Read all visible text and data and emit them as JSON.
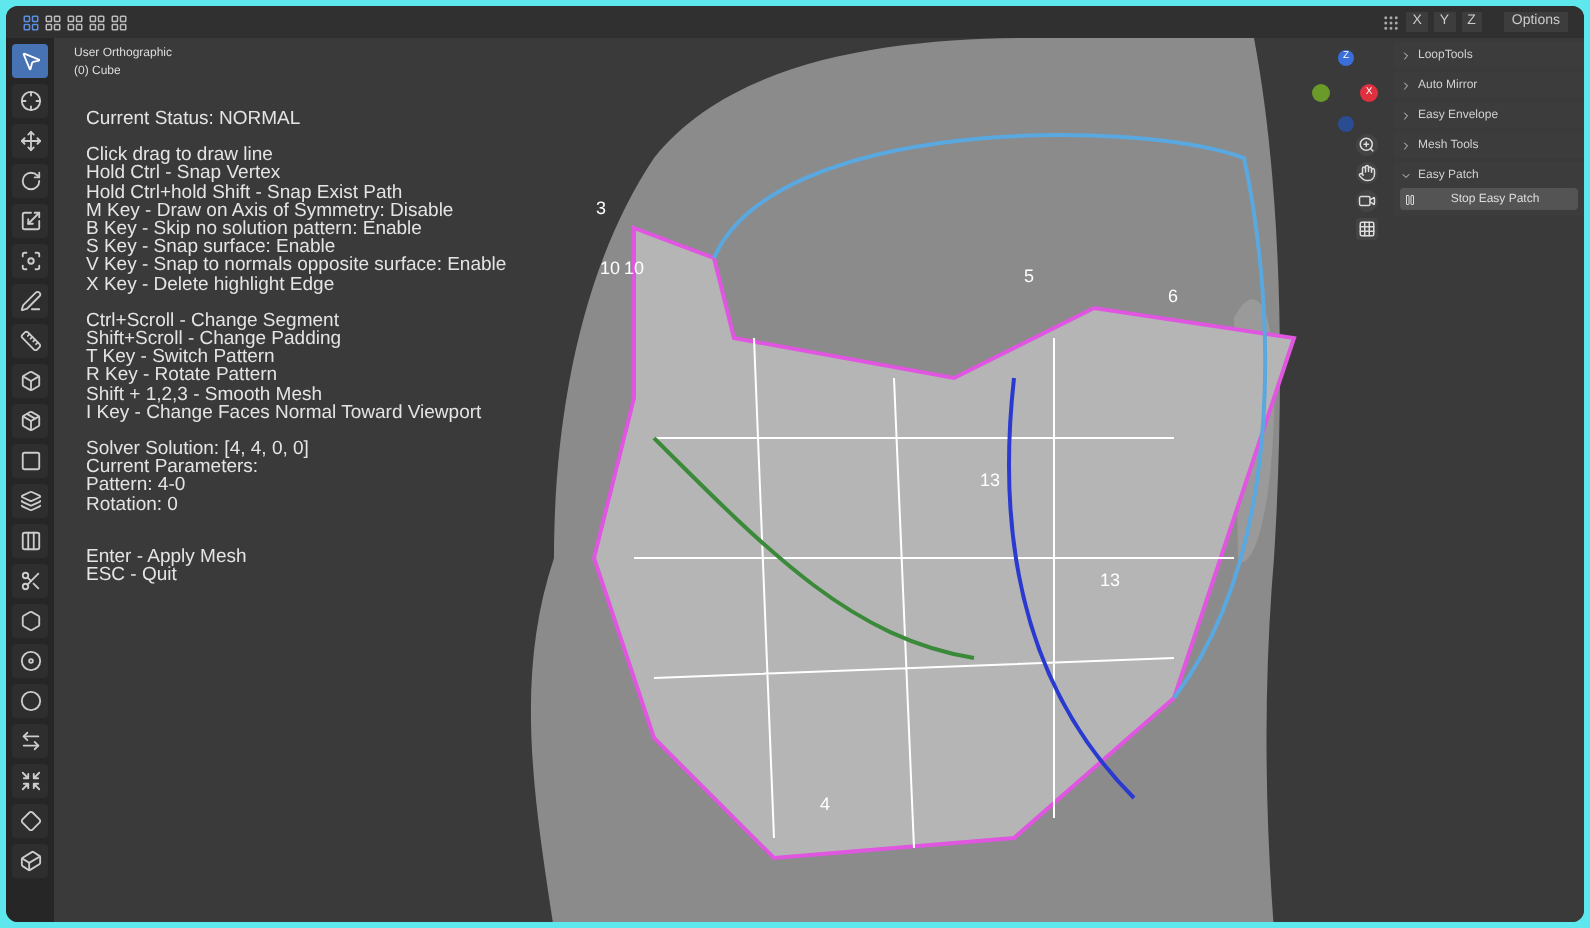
{
  "header": {
    "axes": [
      "X",
      "Y",
      "Z"
    ],
    "options": "Options"
  },
  "toolbar": [
    {
      "kind": "select",
      "selected": true
    },
    {
      "kind": "cursor",
      "selected": false
    },
    {
      "kind": "move",
      "selected": false
    },
    {
      "kind": "rotate",
      "selected": false
    },
    {
      "kind": "scale",
      "selected": false
    },
    {
      "kind": "transform",
      "selected": false
    },
    {
      "kind": "annotate",
      "selected": false
    },
    {
      "kind": "measure",
      "selected": false
    },
    {
      "kind": "add-cube",
      "selected": false
    },
    {
      "kind": "extrude",
      "selected": false
    },
    {
      "kind": "inset",
      "selected": false
    },
    {
      "kind": "bevel",
      "selected": false
    },
    {
      "kind": "loop-cut",
      "selected": false
    },
    {
      "kind": "knife",
      "selected": false
    },
    {
      "kind": "poly-build",
      "selected": false
    },
    {
      "kind": "spin",
      "selected": false
    },
    {
      "kind": "smooth",
      "selected": false
    },
    {
      "kind": "edge-slide",
      "selected": false
    },
    {
      "kind": "shrink",
      "selected": false
    },
    {
      "kind": "shear",
      "selected": false
    },
    {
      "kind": "rip",
      "selected": false
    }
  ],
  "viewport": {
    "view_name": "User Orthographic",
    "object_name": "(0) Cube"
  },
  "status_groups": [
    [
      "Current Status: NORMAL"
    ],
    [
      "Click drag to draw line",
      "Hold Ctrl - Snap Vertex",
      "Hold Ctrl+hold Shift - Snap Exist Path",
      "M Key - Draw on Axis of Symmetry: Disable",
      "B Key - Skip no solution pattern: Enable",
      "S Key - Snap surface: Enable",
      "V Key - Snap to normals opposite surface: Enable",
      "X Key - Delete highlight Edge"
    ],
    [
      "Ctrl+Scroll - Change Segment",
      "Shift+Scroll - Change Padding",
      "T Key - Switch Pattern",
      "R Key - Rotate Pattern",
      "Shift + 1,2,3 - Smooth Mesh",
      "I Key - Change Faces Normal Toward Viewport"
    ],
    [
      "Solver Solution: [4, 4, 0, 0]",
      "Current Parameters:",
      "Pattern: 4-0",
      "Rotation: 0"
    ],
    [
      "Enter - Apply Mesh",
      "ESC - Quit"
    ]
  ],
  "mesh_labels": [
    "3",
    "10",
    "10",
    "5",
    "6",
    "13",
    "13",
    "4"
  ],
  "gizmo": {
    "z_label": "Z",
    "x_label": "X"
  },
  "panels": [
    {
      "label": "LoopTools",
      "expanded": false
    },
    {
      "label": "Auto Mirror",
      "expanded": false
    },
    {
      "label": "Easy Envelope",
      "expanded": false
    },
    {
      "label": "Mesh Tools",
      "expanded": false
    },
    {
      "label": "Easy Patch",
      "expanded": true,
      "button": "Stop Easy Patch"
    }
  ]
}
